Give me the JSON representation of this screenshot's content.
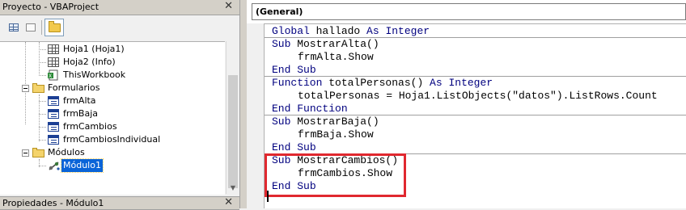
{
  "project_explorer": {
    "title": "Proyecto - VBAProject",
    "close_glyph": "✕",
    "toolbar": {
      "view_code_icon": "view-code-icon",
      "view_object_icon": "view-object-icon",
      "toggle_folders_icon": "folder-icon"
    },
    "tree": [
      {
        "label": "Hoja1 (Hoja1)",
        "icon": "sheet-icon"
      },
      {
        "label": "Hoja2 (Info)",
        "icon": "sheet-icon"
      },
      {
        "label": "ThisWorkbook",
        "icon": "workbook-icon"
      },
      {
        "label": "Formularios",
        "icon": "folder-icon"
      },
      {
        "label": "frmAlta",
        "icon": "form-icon"
      },
      {
        "label": "frmBaja",
        "icon": "form-icon"
      },
      {
        "label": "frmCambios",
        "icon": "form-icon"
      },
      {
        "label": "frmCambiosIndividual",
        "icon": "form-icon"
      },
      {
        "label": "Módulos",
        "icon": "folder-icon"
      },
      {
        "label": "Módulo1",
        "icon": "module-icon",
        "selected": true
      }
    ]
  },
  "properties": {
    "title": "Propiedades - Módulo1",
    "close_glyph": "✕"
  },
  "code_window": {
    "object_combo_value": "(General)",
    "lines": [
      {
        "kw": "Global",
        "rest": " hallado ",
        "kw2": "As",
        "rest2": " ",
        "kw3": "Integer"
      },
      {
        "kw": "Sub",
        "rest": " MostrarAlta()"
      },
      {
        "text": "frmAlta.Show"
      },
      {
        "kw": "End",
        "rest": " ",
        "kw2": "Sub"
      },
      {
        "kw": "Function",
        "rest": " totalPersonas() ",
        "kw2": "As",
        "rest2": " ",
        "kw3": "Integer"
      },
      {
        "text": "totalPersonas = Hoja1.ListObjects(\"datos\").ListRows.Count"
      },
      {
        "kw": "End",
        "rest": " ",
        "kw2": "Function"
      },
      {
        "kw": "Sub",
        "rest": " MostrarBaja()"
      },
      {
        "text": "frmBaja.Show"
      },
      {
        "kw": "End",
        "rest": " ",
        "kw2": "Sub"
      },
      {
        "kw": "Sub",
        "rest": " MostrarCambios()"
      },
      {
        "text": "frmCambios.Show"
      },
      {
        "kw": "End",
        "rest": " ",
        "kw2": "Sub"
      }
    ],
    "keyword_color": "#00007f",
    "highlight_color": "#e0282f"
  }
}
